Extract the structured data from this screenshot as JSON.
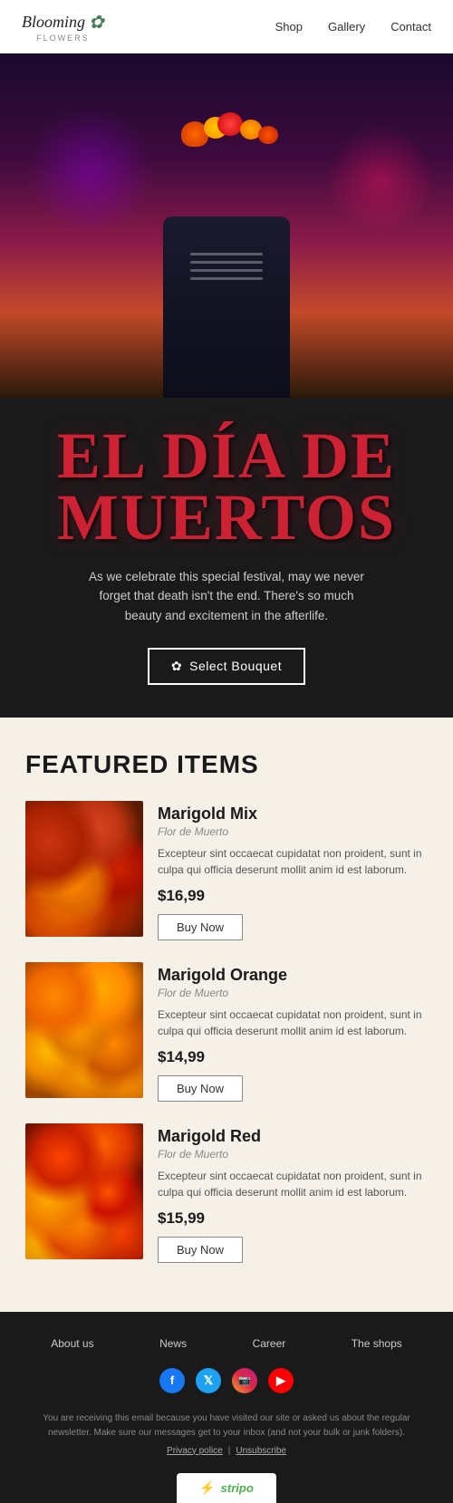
{
  "brand": {
    "name": "Blooming",
    "sub": "FLOWERS",
    "flower_icon": "✿"
  },
  "nav": {
    "links": [
      {
        "label": "Shop"
      },
      {
        "label": "Gallery"
      },
      {
        "label": "Contact"
      }
    ]
  },
  "hero": {
    "title_line1": "EL DÍA DE",
    "title_line2": "MUERTOS",
    "subtitle": "As we celebrate this special festival, may we never forget that death isn't the end. There's so much beauty and excitement in the afterlife.",
    "cta_label": "Select Bouquet",
    "cta_icon": "✿"
  },
  "featured": {
    "section_title": "FEATURED ITEMS",
    "products": [
      {
        "name": "Marigold Mix",
        "subtitle": "Flor de Muerto",
        "description": "Excepteur sint occaecat cupidatat non proident, sunt in culpa qui officia deserunt mollit anim id est laborum.",
        "price": "$16,99",
        "cta": "Buy Now",
        "image_class": "img-marigold-mix"
      },
      {
        "name": "Marigold Orange",
        "subtitle": "Flor de Muerto",
        "description": "Excepteur sint occaecat cupidatat non proident, sunt in culpa qui officia deserunt mollit anim id est laborum.",
        "price": "$14,99",
        "cta": "Buy Now",
        "image_class": "img-marigold-orange"
      },
      {
        "name": "Marigold Red",
        "subtitle": "Flor de Muerto",
        "description": "Excepteur sint occaecat cupidatat non proident, sunt in culpa qui officia deserunt mollit anim id est laborum.",
        "price": "$15,99",
        "cta": "Buy Now",
        "image_class": "img-marigold-red"
      }
    ]
  },
  "footer": {
    "links": [
      "About us",
      "News",
      "Career",
      "The shops"
    ],
    "social": [
      {
        "name": "facebook",
        "class": "social-fb",
        "label": "f"
      },
      {
        "name": "twitter",
        "class": "social-tw",
        "label": "t"
      },
      {
        "name": "instagram",
        "class": "social-ig",
        "label": "📷"
      },
      {
        "name": "youtube",
        "class": "social-yt",
        "label": "▶"
      }
    ],
    "disclaimer": "You are receiving this email because you have visited our site or asked us about the regular newsletter. Make sure our messages get to your inbox (and not your bulk or junk folders).",
    "privacy_link": "Privacy police",
    "unsubscribe_link": "Unsubscribe",
    "stripo_label": "stripo"
  }
}
